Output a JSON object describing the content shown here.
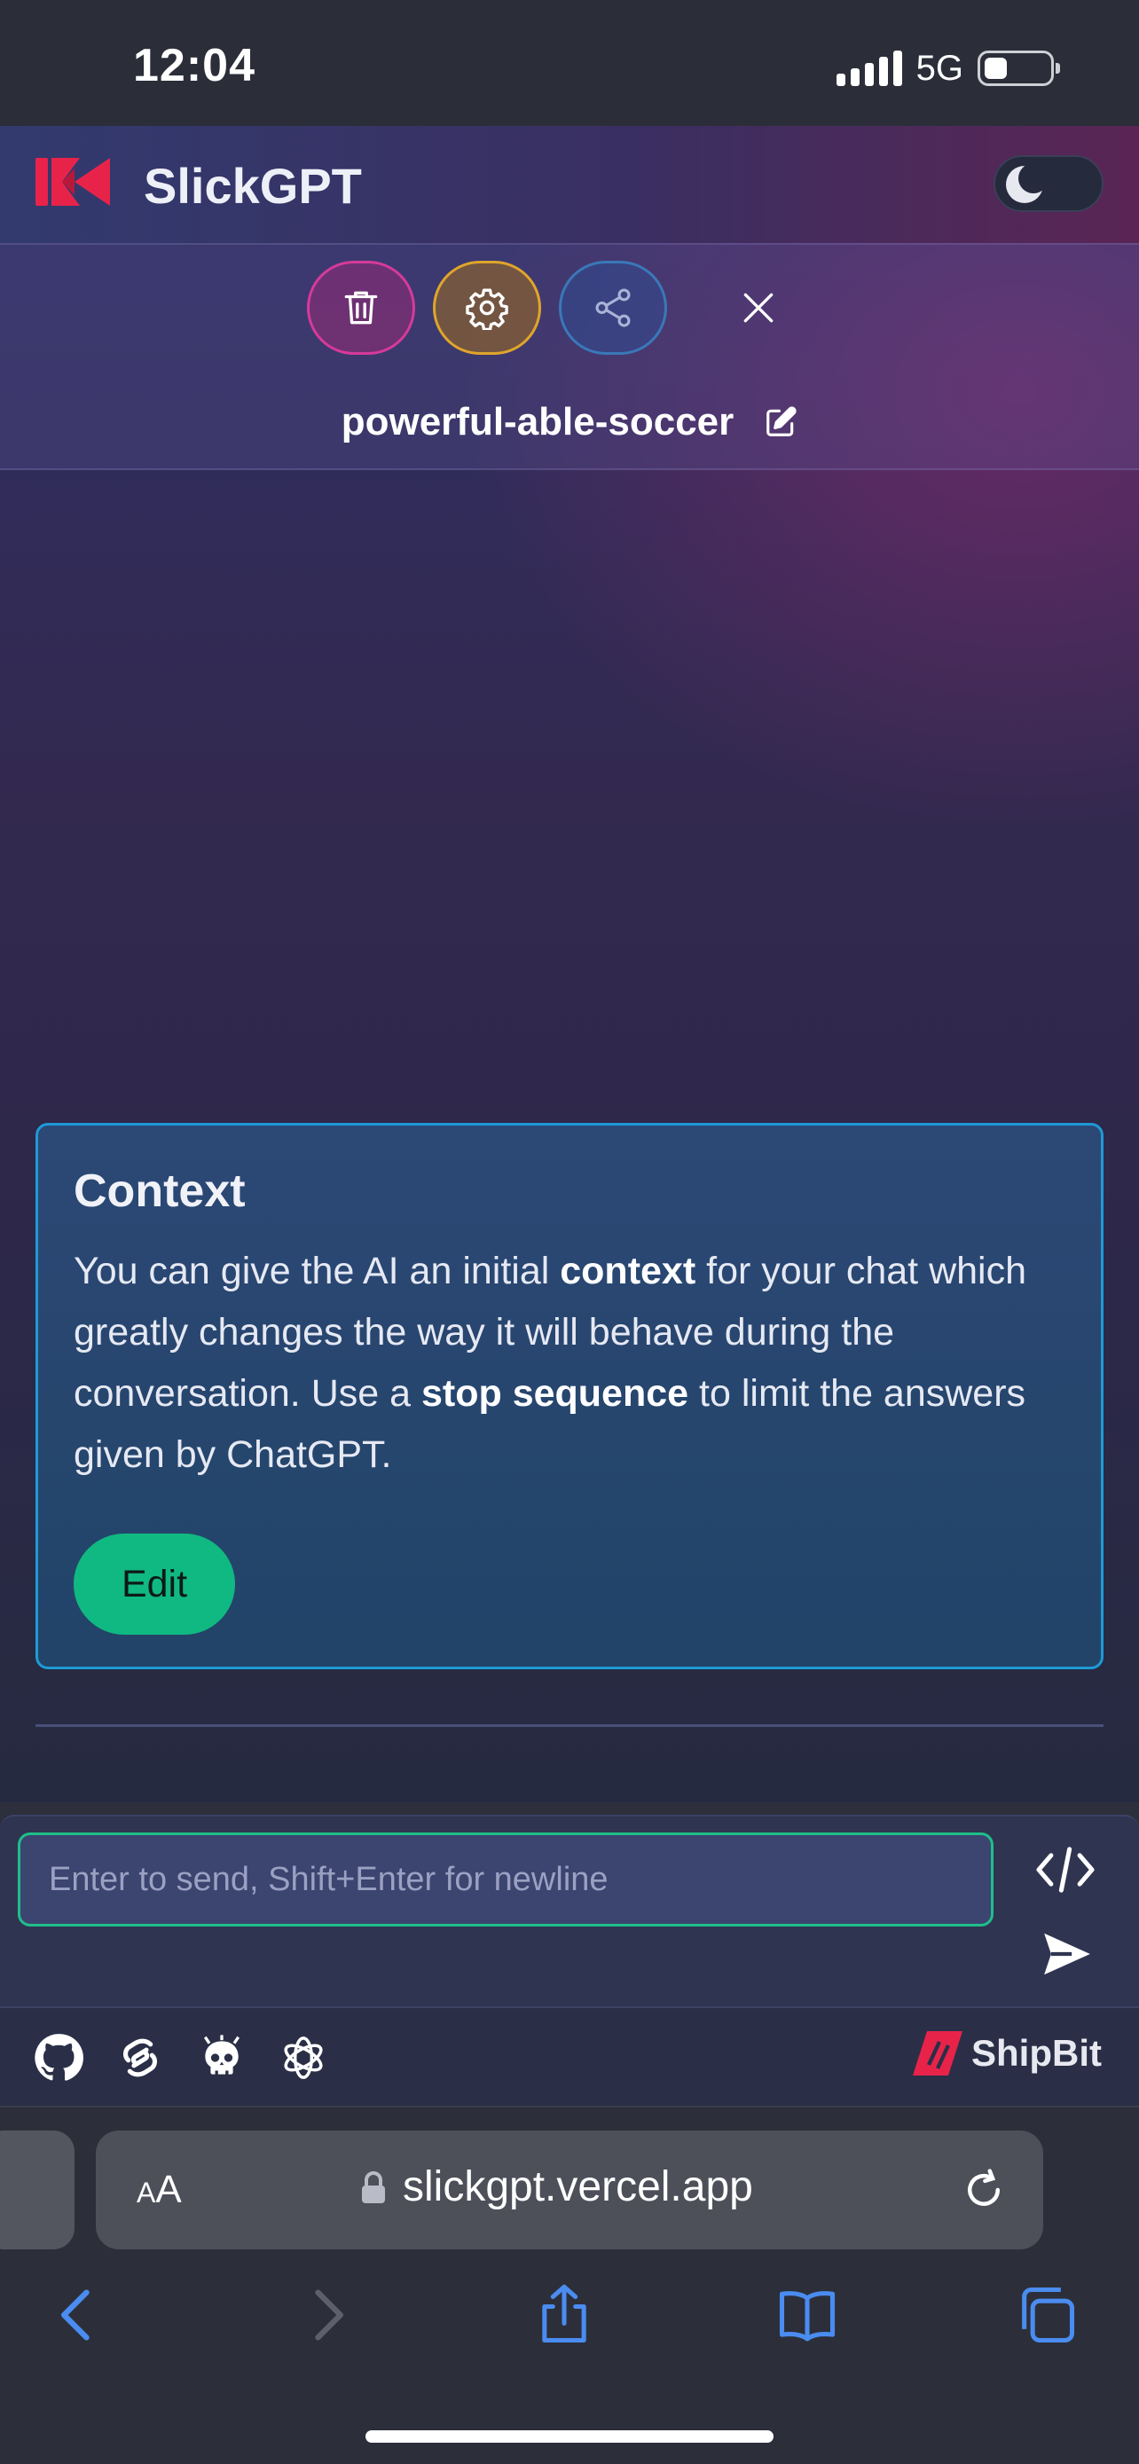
{
  "status_bar": {
    "time": "12:04",
    "network": "5G",
    "battery_level": 0.35
  },
  "header": {
    "app_name": "SlickGPT",
    "logo": "slickgpt-logo",
    "theme_toggle_icon": "moon-icon"
  },
  "toolbar": {
    "delete_icon": "trash-icon",
    "settings_icon": "gear-icon",
    "share_icon": "share-icon",
    "close_icon": "close-icon",
    "chat_name": "powerful-able-soccer",
    "rename_icon": "edit-icon"
  },
  "context_card": {
    "title": "Context",
    "body_1": "You can give the AI an initial ",
    "body_bold_1": "context",
    "body_2": " for your chat which greatly changes the way it will behave during the conversation. Use a ",
    "body_bold_2": "stop sequence",
    "body_3": " to limit the answers given by ChatGPT.",
    "edit_label": "Edit"
  },
  "composer": {
    "placeholder": "Enter to send, Shift+Enter for newline",
    "code_icon": "code-icon",
    "send_icon": "send-icon"
  },
  "footer": {
    "links": [
      "github-icon",
      "svelte-icon",
      "skull-icon",
      "openai-icon"
    ],
    "brand": "ShipBit"
  },
  "browser": {
    "text_size_label_big": "A",
    "text_size_label_small": "A",
    "url": "slickgpt.vercel.app",
    "accent": "#4a8cf0"
  },
  "colors": {
    "accent_green": "#10b981",
    "card_border": "#1e9ad6",
    "delete": "#d63a9a",
    "settings": "#e0a52a",
    "share": "#3a78b8",
    "brand_red": "#e8234a"
  }
}
